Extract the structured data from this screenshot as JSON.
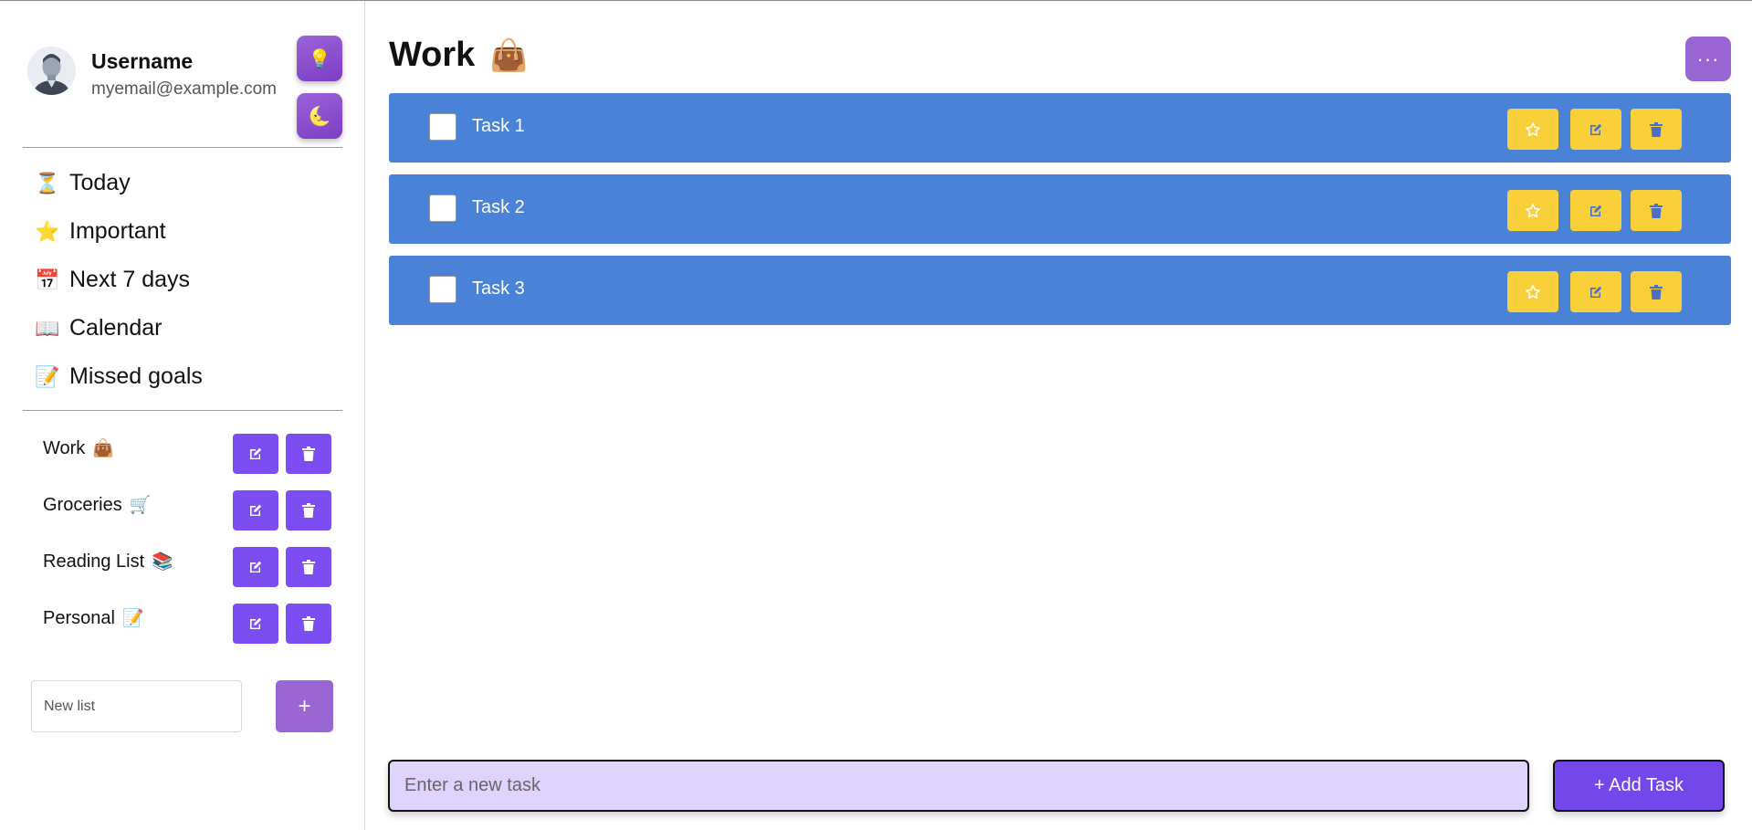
{
  "profile": {
    "username": "Username",
    "email": "myemail@example.com"
  },
  "theme": {
    "light_icon": "lightbulb-icon",
    "dark_icon": "moon-icon"
  },
  "nav": {
    "items": [
      {
        "label": "Today",
        "icon": "hourglass-icon"
      },
      {
        "label": "Important",
        "icon": "star-icon"
      },
      {
        "label": "Next 7 days",
        "icon": "calendar-icon"
      },
      {
        "label": "Calendar",
        "icon": "book-icon"
      },
      {
        "label": "Missed goals",
        "icon": "memo-icon"
      }
    ]
  },
  "lists": {
    "items": [
      {
        "label": "Work",
        "emoji": "👜"
      },
      {
        "label": "Groceries",
        "emoji": "🛒"
      },
      {
        "label": "Reading List",
        "emoji": "📚"
      },
      {
        "label": "Personal",
        "emoji": "📝"
      }
    ],
    "new_list_placeholder": "New list",
    "add_label": "+"
  },
  "main": {
    "title": "Work",
    "title_emoji": "👜",
    "more_label": "···",
    "tasks": [
      {
        "label": "Task 1"
      },
      {
        "label": "Task 2"
      },
      {
        "label": "Task 3"
      }
    ],
    "new_task_placeholder": "Enter a new task",
    "add_task_label": "+ Add Task"
  },
  "colors": {
    "task_bg": "#4a82d8",
    "task_button": "#f9cf3a",
    "list_button": "#7c4df0",
    "accent_purple": "#9a66d3",
    "input_bg": "#ddd3fd"
  }
}
